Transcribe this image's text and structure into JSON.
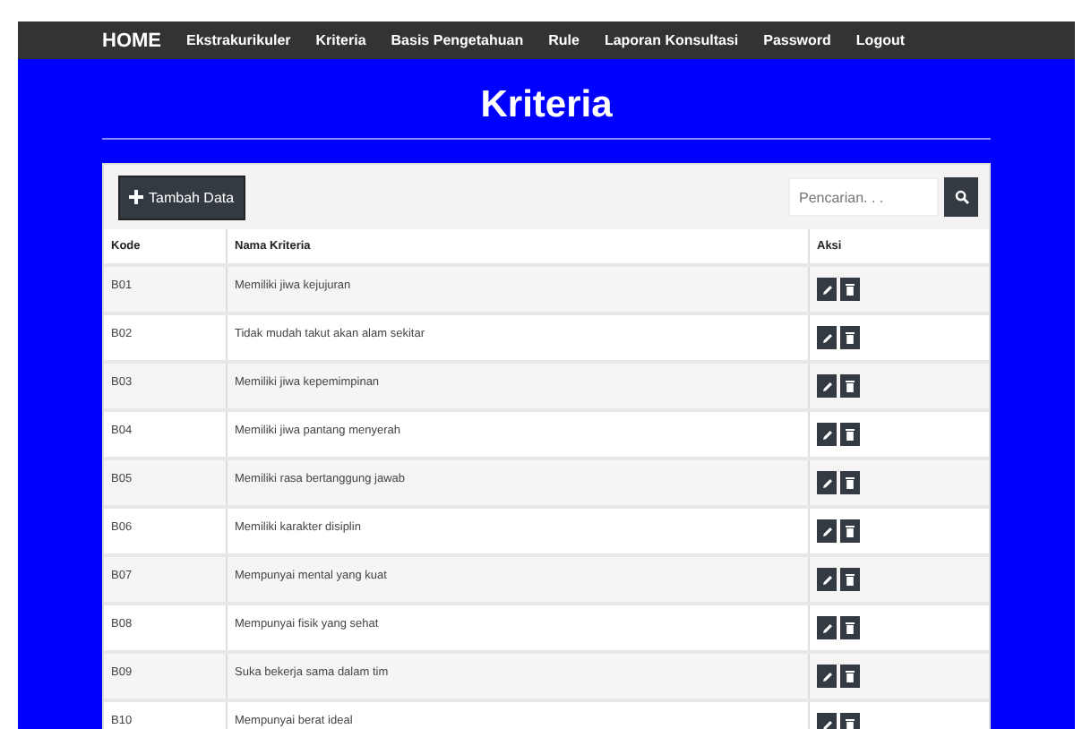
{
  "nav": {
    "brand": "HOME",
    "items": [
      "Ekstrakurikuler",
      "Kriteria",
      "Basis Pengetahuan",
      "Rule",
      "Laporan Konsultasi",
      "Password",
      "Logout"
    ]
  },
  "page_title": "Kriteria",
  "toolbar": {
    "add_button": "Tambah Data",
    "search": {
      "placeholder": "Pencarian. . ."
    }
  },
  "table": {
    "columns": [
      "Kode",
      "Nama Kriteria",
      "Aksi"
    ],
    "rows": [
      {
        "code": "B01",
        "name": "Memiliki jiwa kejujuran"
      },
      {
        "code": "B02",
        "name": "Tidak mudah takut akan alam sekitar"
      },
      {
        "code": "B03",
        "name": "Memiliki jiwa kepemimpinan"
      },
      {
        "code": "B04",
        "name": "Memiliki jiwa pantang menyerah"
      },
      {
        "code": "B05",
        "name": "Memiliki rasa bertanggung jawab"
      },
      {
        "code": "B06",
        "name": "Memiliki karakter disiplin"
      },
      {
        "code": "B07",
        "name": "Mempunyai mental yang kuat"
      },
      {
        "code": "B08",
        "name": "Mempunyai fisik yang sehat"
      },
      {
        "code": "B09",
        "name": "Suka bekerja sama dalam tim"
      },
      {
        "code": "B10",
        "name": "Mempunyai berat ideal"
      }
    ]
  }
}
